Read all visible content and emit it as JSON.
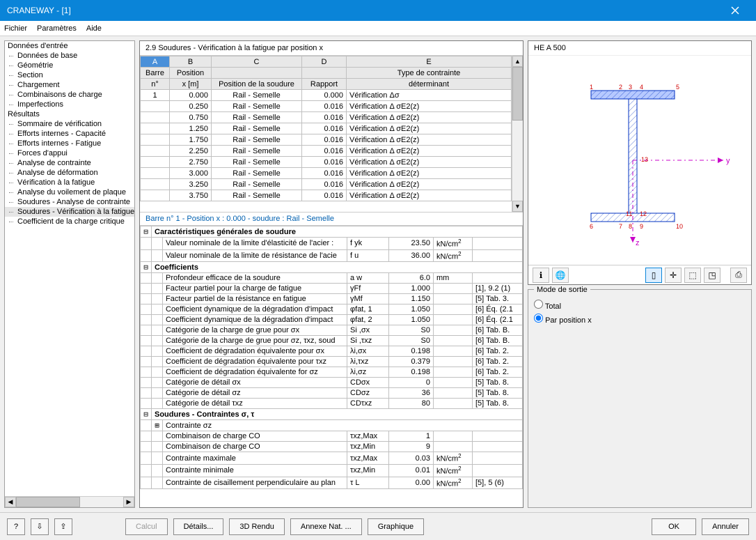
{
  "window": {
    "title": "CRANEWAY - [1]"
  },
  "menu": [
    "Fichier",
    "Paramètres",
    "Aide"
  ],
  "nav": {
    "cat1": "Données d'entrée",
    "items1": [
      "Données de base",
      "Géométrie",
      "Section",
      "Chargement",
      "Combinaisons de charge",
      "Imperfections"
    ],
    "cat2": "Résultats",
    "items2": [
      "Sommaire de vérification",
      "Efforts internes - Capacité",
      "Efforts internes - Fatigue",
      "Forces d'appui",
      "Analyse de contrainte",
      "Analyse de déformation",
      "Vérification à la fatigue",
      "Analyse du voilement de plaque",
      "Soudures - Analyse de contrainte",
      "Soudures - Vérification à la fatigue",
      "Coefficient de la charge critique"
    ]
  },
  "section_title": "2.9 Soudures - Vérification à la fatigue par position x",
  "table": {
    "col_letters": [
      "A",
      "B",
      "C",
      "D",
      "E"
    ],
    "headers1": [
      "Barre",
      "Position",
      "",
      "",
      "Type de contrainte"
    ],
    "headers2": [
      "n°",
      "x [m]",
      "Position de la soudure",
      "Rapport",
      "déterminant"
    ],
    "rows": [
      {
        "a": "1",
        "b": "0.000",
        "c": "Rail - Semelle",
        "d": "0.000",
        "e": "Vérification  Δσ"
      },
      {
        "a": "",
        "b": "0.250",
        "c": "Rail - Semelle",
        "d": "0.016",
        "e": "Vérification  Δ σE2(z)"
      },
      {
        "a": "",
        "b": "0.750",
        "c": "Rail - Semelle",
        "d": "0.016",
        "e": "Vérification  Δ σE2(z)"
      },
      {
        "a": "",
        "b": "1.250",
        "c": "Rail - Semelle",
        "d": "0.016",
        "e": "Vérification  Δ σE2(z)"
      },
      {
        "a": "",
        "b": "1.750",
        "c": "Rail - Semelle",
        "d": "0.016",
        "e": "Vérification  Δ σE2(z)"
      },
      {
        "a": "",
        "b": "2.250",
        "c": "Rail - Semelle",
        "d": "0.016",
        "e": "Vérification  Δ σE2(z)"
      },
      {
        "a": "",
        "b": "2.750",
        "c": "Rail - Semelle",
        "d": "0.016",
        "e": "Vérification  Δ σE2(z)"
      },
      {
        "a": "",
        "b": "3.000",
        "c": "Rail - Semelle",
        "d": "0.016",
        "e": "Vérification  Δ σE2(z)"
      },
      {
        "a": "",
        "b": "3.250",
        "c": "Rail - Semelle",
        "d": "0.016",
        "e": "Vérification  Δ σE2(z)"
      },
      {
        "a": "",
        "b": "3.750",
        "c": "Rail - Semelle",
        "d": "0.016",
        "e": "Vérification  Δ σE2(z)"
      }
    ]
  },
  "detail_title": "Barre n°  1  -  Position x :  0.000  -  soudure : Rail - Semelle",
  "details": [
    {
      "t": "hdr",
      "exp": "⊟",
      "label": "Caractéristiques générales de soudure"
    },
    {
      "t": "row",
      "label": "Valeur nominale de la limite d'élasticité de l'acier :",
      "sym": "f yk",
      "val": "23.50",
      "unit": "kN/cm²",
      "ref": ""
    },
    {
      "t": "row",
      "label": "Valeur nominale de la limite de résistance de l'acie",
      "sym": "f u",
      "val": "36.00",
      "unit": "kN/cm²",
      "ref": ""
    },
    {
      "t": "hdr",
      "exp": "⊟",
      "label": "Coefficients"
    },
    {
      "t": "row",
      "label": "Profondeur efficace de la soudure",
      "sym": "a w",
      "val": "6.0",
      "unit": "mm",
      "ref": ""
    },
    {
      "t": "row",
      "label": "Facteur partiel pour la charge de fatigue",
      "sym": "γFf",
      "val": "1.000",
      "unit": "",
      "ref": "[1], 9.2 (1)"
    },
    {
      "t": "row",
      "label": "Facteur partiel de la résistance en fatigue",
      "sym": "γMf",
      "val": "1.150",
      "unit": "",
      "ref": "[5] Tab. 3."
    },
    {
      "t": "row",
      "label": "Coefficient dynamique de la dégradation d'impact",
      "sym": "φfat, 1",
      "val": "1.050",
      "unit": "",
      "ref": "[6] Éq. (2.1"
    },
    {
      "t": "row",
      "label": "Coefficient dynamique de la dégradation d'impact",
      "sym": "φfat, 2",
      "val": "1.050",
      "unit": "",
      "ref": "[6] Éq. (2.1"
    },
    {
      "t": "row",
      "label": "Catégorie de la charge de grue pour σx",
      "sym": "Si ,σx",
      "val": "S0",
      "unit": "",
      "ref": "[6] Tab. B."
    },
    {
      "t": "row",
      "label": "Catégorie de la charge de grue pour σz, τxz, soud",
      "sym": "Si ,τxz",
      "val": "S0",
      "unit": "",
      "ref": "[6] Tab. B."
    },
    {
      "t": "row",
      "label": "Coefficient de dégradation équivalente pour σx",
      "sym": "λi,σx",
      "val": "0.198",
      "unit": "",
      "ref": "[6] Tab. 2."
    },
    {
      "t": "row",
      "label": "Coefficient de dégradation équivalente pour τxz",
      "sym": "λi,τxz",
      "val": "0.379",
      "unit": "",
      "ref": "[6] Tab. 2."
    },
    {
      "t": "row",
      "label": "Coefficient de dégradation équivalente for σz",
      "sym": "λi,σz",
      "val": "0.198",
      "unit": "",
      "ref": "[6] Tab. 2."
    },
    {
      "t": "row",
      "label": "Catégorie de détail σx",
      "sym": "CDσx",
      "val": "0",
      "unit": "",
      "ref": "[5] Tab. 8."
    },
    {
      "t": "row",
      "label": "Catégorie de détail σz",
      "sym": "CDσz",
      "val": "36",
      "unit": "",
      "ref": "[5] Tab. 8."
    },
    {
      "t": "row",
      "label": "Catégorie de détail τxz",
      "sym": "CDτxz",
      "val": "80",
      "unit": "",
      "ref": "[5] Tab. 8."
    },
    {
      "t": "hdr",
      "exp": "⊟",
      "label": "Soudures - Contraintes σ, τ"
    },
    {
      "t": "sub",
      "exp": "⊞",
      "label": "Contrainte σz"
    },
    {
      "t": "row",
      "label": "Combinaison de charge CO",
      "sym": "τxz,Max",
      "val": "1",
      "unit": "",
      "ref": ""
    },
    {
      "t": "row",
      "label": "Combinaison de charge CO",
      "sym": "τxz,Min",
      "val": "9",
      "unit": "",
      "ref": ""
    },
    {
      "t": "row",
      "label": "Contrainte maximale",
      "sym": "τxz,Max",
      "val": "0.03",
      "unit": "kN/cm²",
      "ref": ""
    },
    {
      "t": "row",
      "label": "Contrainte minimale",
      "sym": "τxz,Min",
      "val": "0.01",
      "unit": "kN/cm²",
      "ref": ""
    },
    {
      "t": "row",
      "label": "Contrainte de cisaillement perpendiculaire au plan",
      "sym": "τ L",
      "val": "0.00",
      "unit": "kN/cm²",
      "ref": "[5], 5 (6)"
    }
  ],
  "section_label": "HE A 500",
  "mode_box": {
    "title": "Mode de sortie",
    "opt1": "Total",
    "opt2": "Par position x",
    "selected": 2
  },
  "footer": {
    "calc": "Calcul",
    "details": "Détails...",
    "render": "3D Rendu",
    "annex": "Annexe Nat. ...",
    "graph": "Graphique",
    "ok": "OK",
    "cancel": "Annuler"
  }
}
